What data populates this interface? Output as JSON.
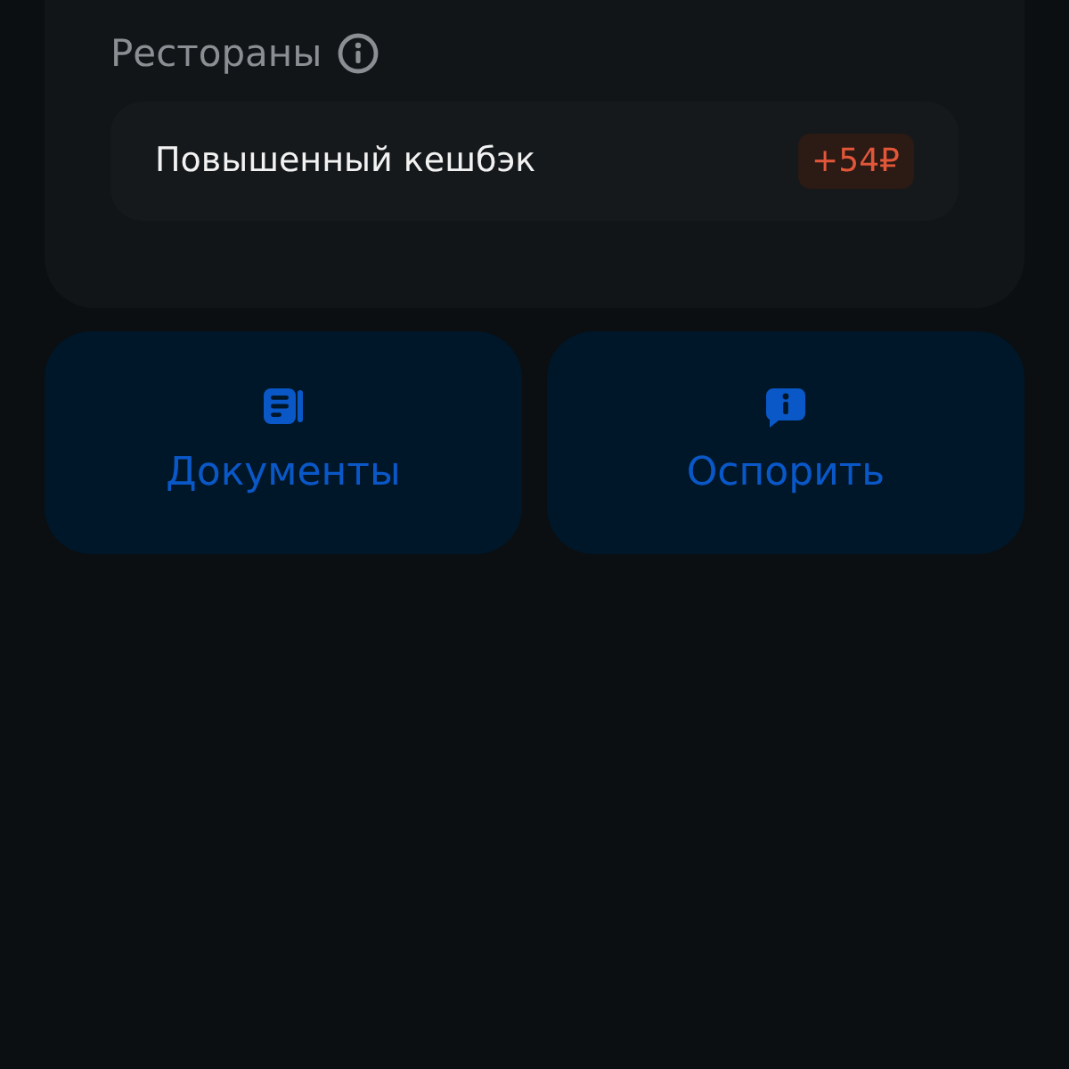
{
  "section": {
    "title": "Рестораны",
    "rows": [
      {
        "label": "Повышенный кешбэк",
        "amount": "+54₽"
      }
    ]
  },
  "actions": [
    {
      "label": "Документы",
      "kind": "document"
    },
    {
      "label": "Оспорить",
      "kind": "dispute"
    }
  ]
}
